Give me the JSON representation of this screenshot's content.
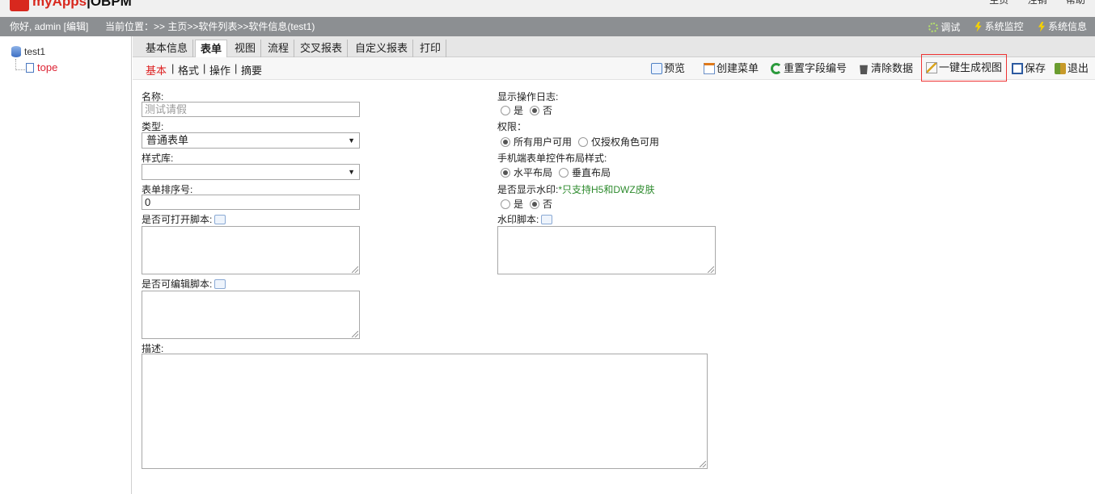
{
  "header": {
    "brand": "myApps",
    "product": "|OBPM",
    "links": [
      "主页",
      "注销",
      "帮助"
    ]
  },
  "status": {
    "greeting": "你好, admin [编辑]",
    "breadcrumb": "当前位置：>> 主页>>软件列表>>软件信息(test1)",
    "debug": "调试",
    "monitor": "系统监控",
    "sysinfo": "系统信息"
  },
  "tree": {
    "root": "test1",
    "child": "tope"
  },
  "tabs": [
    "基本信息",
    "表单",
    "视图",
    "流程",
    "交叉报表",
    "自定义报表",
    "打印"
  ],
  "subtabs": [
    "基本",
    "格式",
    "操作",
    "摘要"
  ],
  "toolbar": {
    "preview": "预览",
    "create_menu": "创建菜单",
    "reset_fields": "重置字段编号",
    "clear_data": "清除数据",
    "gen_view": "一键生成视图",
    "save": "保存",
    "exit": "退出"
  },
  "form": {
    "name_label": "名称:",
    "name_value": "测试请假",
    "type_label": "类型:",
    "type_value": "普通表单",
    "style_label": "样式库:",
    "style_value": "",
    "order_label": "表单排序号:",
    "order_value": "0",
    "open_script_label": "是否可打开脚本:",
    "edit_script_label": "是否可编辑脚本:",
    "desc_label": "描述:",
    "log_label": "显示操作日志:",
    "yes": "是",
    "no": "否",
    "perm_label": "权限：",
    "perm_all": "所有用户可用",
    "perm_role": "仅授权角色可用",
    "mobile_label": "手机端表单控件布局样式:",
    "mobile_h": "水平布局",
    "mobile_v": "垂直布局",
    "watermark_label": "是否显示水印:",
    "watermark_note": "*只支持H5和DWZ皮肤",
    "watermark_script_label": "水印脚本:"
  },
  "colors": {
    "brand": "#d8281e",
    "statusbar": "#8c8f92",
    "active_subtab": "#d22222",
    "note": "#2e8b2e"
  }
}
